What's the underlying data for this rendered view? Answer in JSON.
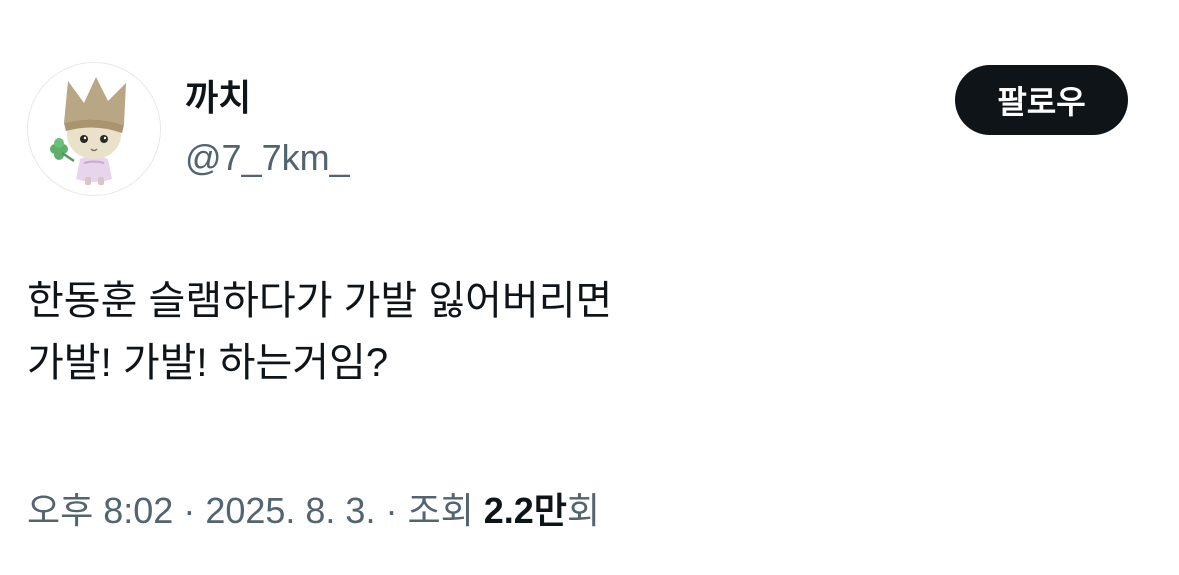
{
  "author": {
    "display_name": "까치",
    "handle": "@7_7km_",
    "avatar_icon": "kitten-doll-avatar-icon"
  },
  "follow_button": {
    "label": "팔로우"
  },
  "tweet": {
    "lines": [
      "한동훈 슬램하다가 가발 잃어버리면",
      "가발! 가발! 하는거임?"
    ]
  },
  "meta": {
    "time": "오후 8:02",
    "separator": " · ",
    "date": "2025. 8. 3.",
    "views_label": "조회",
    "views_count": "2.2만",
    "views_suffix": "회"
  },
  "colors": {
    "text_primary": "#0f1419",
    "text_secondary": "#536471",
    "button_bg": "#0f1419",
    "button_text": "#ffffff"
  }
}
